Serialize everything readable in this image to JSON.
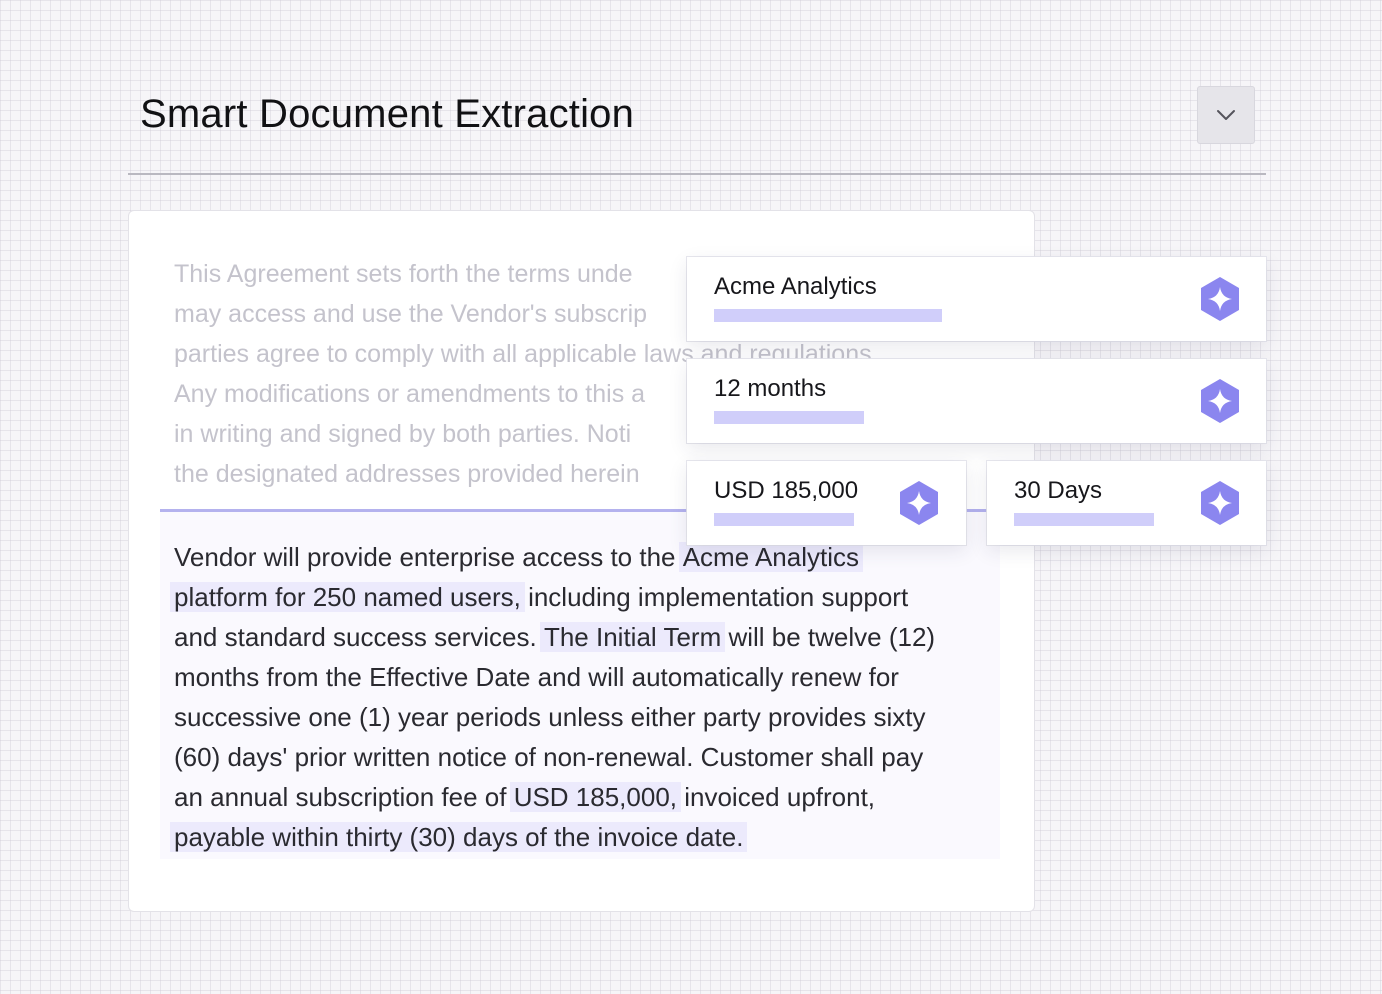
{
  "header": {
    "title": "Smart Document Extraction"
  },
  "document": {
    "faded_lines": [
      "This Agreement sets forth the terms unde",
      "may access and use the Vendor's subscrip",
      "parties agree to comply with all applicable laws and regulations",
      "Any modifications or amendments to this a",
      "in writing and signed by both parties. Noti",
      "the designated addresses provided herein"
    ],
    "clause": {
      "l1_a": "Vendor will provide enterprise access to the ",
      "l1_hl": "Acme Analytics",
      "l2_hl": "platform for 250 named users,",
      "l2_b": " including implementation support",
      "l3_a": "and standard success services. ",
      "l3_hl": "The Initial Term",
      "l3_b": " will be twelve (12)",
      "l4": "months from the Effective Date and will automatically renew for",
      "l5": "successive one (1) year periods unless either party provides sixty",
      "l6": "(60) days' prior written notice of non-renewal. Customer shall pay",
      "l7_a": "an annual subscription fee of ",
      "l7_hl": "USD 185,000,",
      "l7_b": " invoiced upfront,",
      "l8_hl": "payable within thirty (30) days of the invoice date."
    }
  },
  "extracted_fields": {
    "vendor": "Acme Analytics",
    "term": "12 months",
    "fee": "USD 185,000",
    "payment_terms": "30 Days"
  },
  "colors": {
    "accent": "#8b86ef",
    "highlight": "#eceafc",
    "bar": "#d0cefa"
  },
  "icons": {
    "collapse": "chevron-down-icon",
    "ai": "sparkle-icon"
  }
}
